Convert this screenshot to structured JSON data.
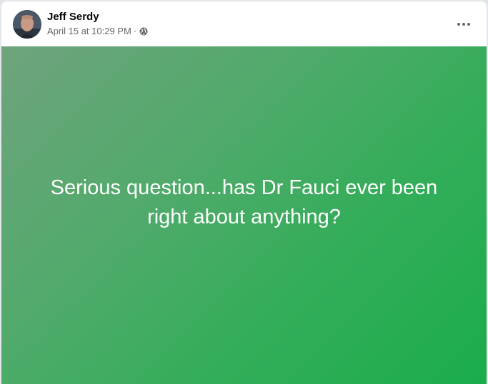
{
  "post": {
    "author": "Jeff Serdy",
    "timestamp": "April 15 at 10:29 PM",
    "separator": "·",
    "audience_icon": "globe-icon",
    "menu_icon": "more-horizontal-icon",
    "text": "Serious question...has Dr Fauci ever been right about anything?",
    "background_gradient": [
      "#6fa37d",
      "#1aad4b"
    ]
  },
  "colors": {
    "name": "#050505",
    "meta": "#65676b",
    "post_text": "#ffffff"
  }
}
